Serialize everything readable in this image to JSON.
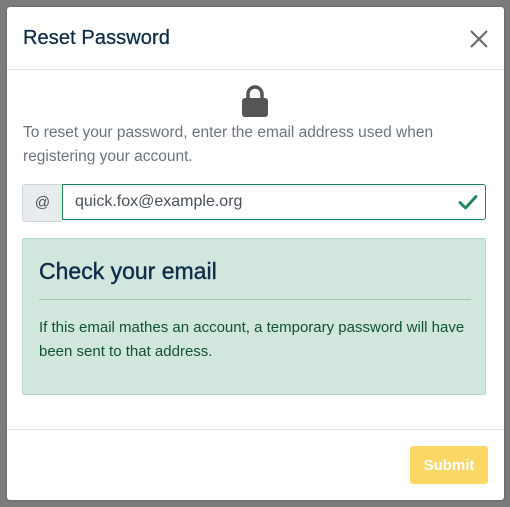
{
  "modal": {
    "title": "Reset Password",
    "instructions": "To reset your password, enter the email address used when registering your account."
  },
  "email_field": {
    "prepend_symbol": "@",
    "value": "quick.fox@example.org",
    "validation_state": "valid"
  },
  "alert": {
    "heading": "Check your email",
    "body": "If this email mathes an account, a temporary password will have been sent to that address."
  },
  "footer": {
    "submit_label": "Submit",
    "submit_state": "disabled"
  },
  "icons": {
    "close": "close-icon",
    "lock": "lock-icon",
    "check": "check-icon"
  },
  "colors": {
    "title": "#0e2c4a",
    "success": "#198754",
    "alert_bg": "#d1e7dd",
    "alert_text": "#0f5132",
    "submit_bg": "#fbd55e",
    "backdrop": "#7c7c7c"
  }
}
